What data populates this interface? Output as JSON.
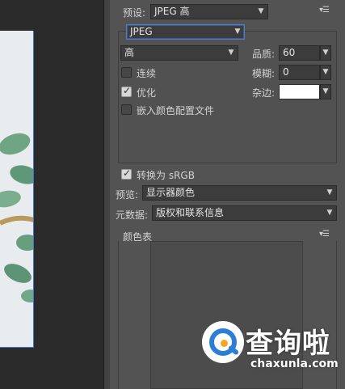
{
  "preset": {
    "label": "预设:",
    "value": "JPEG 高"
  },
  "format": {
    "value": "JPEG"
  },
  "quality_preset": {
    "value": "高"
  },
  "quality": {
    "label": "品质:",
    "value": "60"
  },
  "blur": {
    "label": "模糊:",
    "value": "0"
  },
  "matte": {
    "label": "杂边:",
    "color": "#ffffff"
  },
  "options": {
    "progressive": {
      "label": "连续",
      "checked": false
    },
    "optimized": {
      "label": "优化",
      "checked": true
    },
    "embed_profile": {
      "label": "嵌入颜色配置文件",
      "checked": false
    }
  },
  "convert_srgb": {
    "label": "转换为 sRGB",
    "checked": true
  },
  "preview": {
    "label": "预览:",
    "value": "显示器颜色"
  },
  "metadata": {
    "label": "元数据:",
    "value": "版权和联系信息"
  },
  "color_table": {
    "label": "颜色表"
  },
  "watermark": {
    "title": "查询啦",
    "domain": "chaxunla.com"
  },
  "icons": {
    "dropdown": "chevron-down-icon",
    "panel_menu": "panel-menu-icon",
    "check": "checkmark-icon"
  }
}
